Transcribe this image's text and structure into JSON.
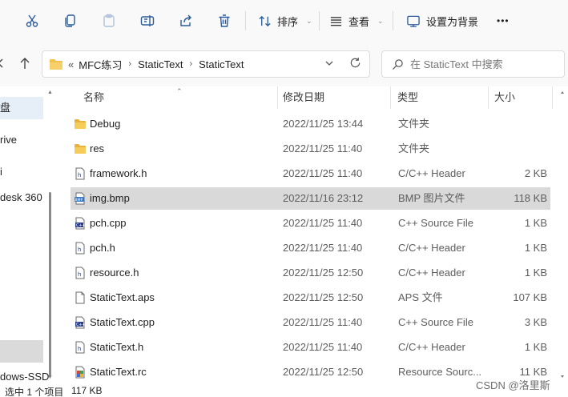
{
  "toolbar": {
    "sort_label": "排序",
    "view_label": "查看",
    "set_bg_label": "设置为背景",
    "more_label": "•••"
  },
  "address": {
    "overflow": "«",
    "crumbs": [
      "MFC练习",
      "StaticText",
      "StaticText"
    ]
  },
  "search": {
    "placeholder": "在 StaticText 中搜索"
  },
  "sidebar": {
    "items": [
      "盘",
      "rive",
      "i",
      "desk 360",
      "dows-SSD"
    ]
  },
  "columns": {
    "name": "名称",
    "date": "修改日期",
    "type": "类型",
    "size": "大小"
  },
  "files": [
    {
      "name": "Debug",
      "date": "2022/11/25 13:44",
      "type": "文件夹",
      "size": "",
      "icon": "folder-icon"
    },
    {
      "name": "res",
      "date": "2022/11/25 11:40",
      "type": "文件夹",
      "size": "",
      "icon": "folder-icon"
    },
    {
      "name": "framework.h",
      "date": "2022/11/25 11:40",
      "type": "C/C++ Header",
      "size": "2 KB",
      "icon": "header-file-icon"
    },
    {
      "name": "img.bmp",
      "date": "2022/11/16 23:12",
      "type": "BMP 图片文件",
      "size": "118 KB",
      "icon": "bmp-file-icon"
    },
    {
      "name": "pch.cpp",
      "date": "2022/11/25 11:40",
      "type": "C++ Source File",
      "size": "1 KB",
      "icon": "cpp-file-icon"
    },
    {
      "name": "pch.h",
      "date": "2022/11/25 11:40",
      "type": "C/C++ Header",
      "size": "1 KB",
      "icon": "header-file-icon"
    },
    {
      "name": "resource.h",
      "date": "2022/11/25 12:50",
      "type": "C/C++ Header",
      "size": "1 KB",
      "icon": "header-file-icon"
    },
    {
      "name": "StaticText.aps",
      "date": "2022/11/25 12:50",
      "type": "APS 文件",
      "size": "107 KB",
      "icon": "blank-file-icon"
    },
    {
      "name": "StaticText.cpp",
      "date": "2022/11/25 11:40",
      "type": "C++ Source File",
      "size": "3 KB",
      "icon": "cpp-file-icon"
    },
    {
      "name": "StaticText.h",
      "date": "2022/11/25 11:40",
      "type": "C/C++ Header",
      "size": "1 KB",
      "icon": "header-file-icon"
    },
    {
      "name": "StaticText.rc",
      "date": "2022/11/25 12:50",
      "type": "Resource Sourc...",
      "size": "11 KB",
      "icon": "rc-file-icon"
    }
  ],
  "selected_index": 3,
  "status": {
    "selection": "选中 1 个项目",
    "size": "117 KB"
  },
  "watermark": "CSDN @洛里斯",
  "colors": {
    "accent": "#2b5b9a",
    "folder": "#f2c14e",
    "selected_row": "#d9d9d9"
  }
}
